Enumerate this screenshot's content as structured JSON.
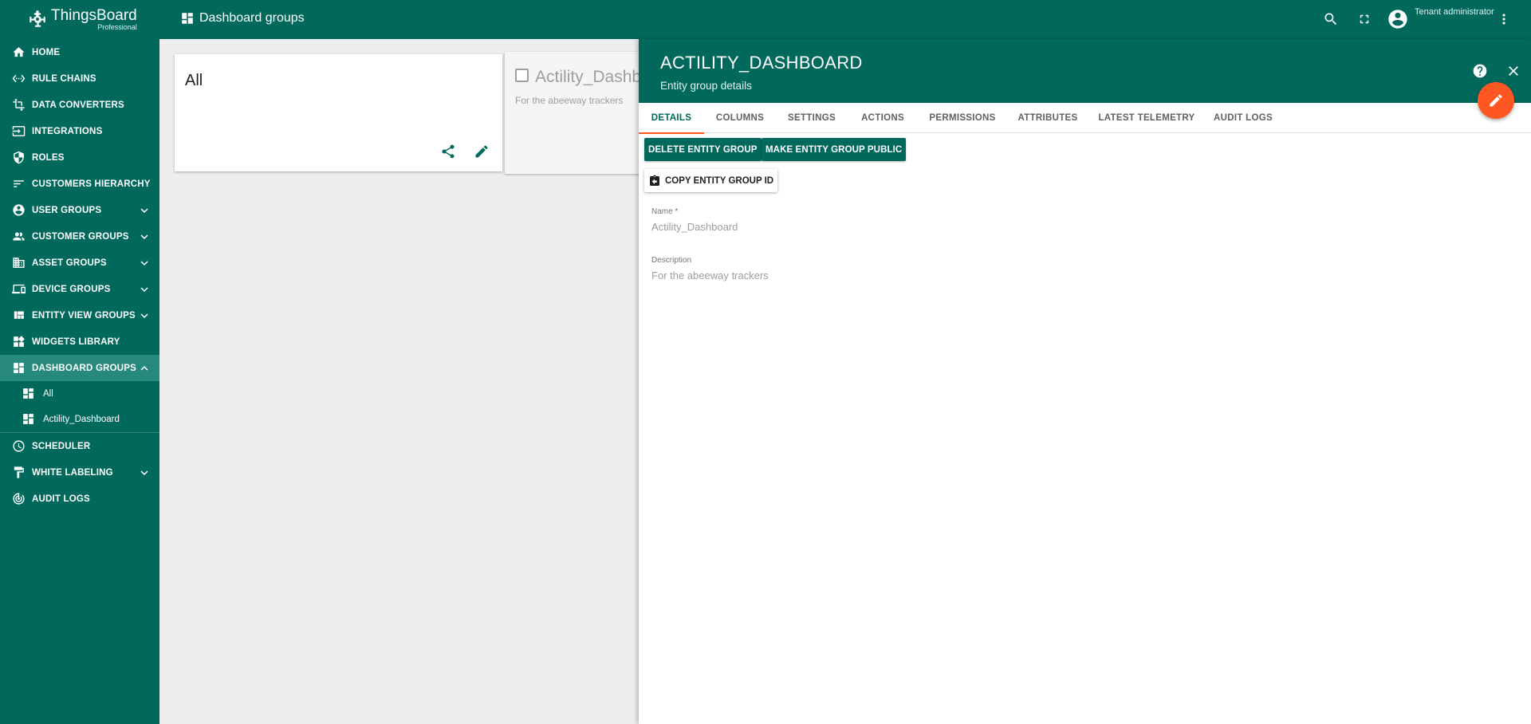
{
  "app": {
    "logo_name": "ThingsBoard",
    "logo_sub": "Professional",
    "accent_color": "#00695c",
    "fab_color": "#ff5722"
  },
  "topbar": {
    "title": "Dashboard groups",
    "user_label": "Tenant administrator"
  },
  "sidebar": {
    "items": [
      {
        "label": "HOME",
        "icon": "home-icon"
      },
      {
        "label": "RULE CHAINS",
        "icon": "settings-ethernet-icon"
      },
      {
        "label": "DATA CONVERTERS",
        "icon": "transform-icon"
      },
      {
        "label": "INTEGRATIONS",
        "icon": "input-icon"
      },
      {
        "label": "ROLES",
        "icon": "security-icon"
      },
      {
        "label": "CUSTOMERS HIERARCHY",
        "icon": "sort-icon"
      },
      {
        "label": "USER GROUPS",
        "icon": "account-circle-icon"
      },
      {
        "label": "CUSTOMER GROUPS",
        "icon": "supervisor-icon"
      },
      {
        "label": "ASSET GROUPS",
        "icon": "domain-icon"
      },
      {
        "label": "DEVICE GROUPS",
        "icon": "devices-icon"
      },
      {
        "label": "ENTITY VIEW GROUPS",
        "icon": "view-quilt-icon"
      },
      {
        "label": "WIDGETS LIBRARY",
        "icon": "widgets-icon"
      },
      {
        "label": "DASHBOARD GROUPS",
        "icon": "dashboard-icon"
      },
      {
        "label": "SCHEDULER",
        "icon": "schedule-icon"
      },
      {
        "label": "WHITE LABELING",
        "icon": "format-paint-icon"
      },
      {
        "label": "AUDIT LOGS",
        "icon": "track-changes-icon"
      }
    ],
    "dashboard_sub": [
      {
        "label": "All"
      },
      {
        "label": "Actility_Dashboard"
      }
    ]
  },
  "cards": {
    "all_title": "All",
    "actility_title": "Actility_Dashboard",
    "actility_desc": "For the abeeway trackers"
  },
  "panel": {
    "title": "ACTILITY_DASHBOARD",
    "subtitle": "Entity group details",
    "tabs": [
      "DETAILS",
      "COLUMNS",
      "SETTINGS",
      "ACTIONS",
      "PERMISSIONS",
      "ATTRIBUTES",
      "LATEST TELEMETRY",
      "AUDIT LOGS"
    ],
    "delete_label": "DELETE ENTITY GROUP",
    "public_label": "MAKE ENTITY GROUP PUBLIC",
    "copy_label": "COPY ENTITY GROUP ID",
    "name_label": "Name *",
    "name_value": "Actility_Dashboard",
    "desc_label": "Description",
    "desc_value": "For the abeeway trackers"
  }
}
